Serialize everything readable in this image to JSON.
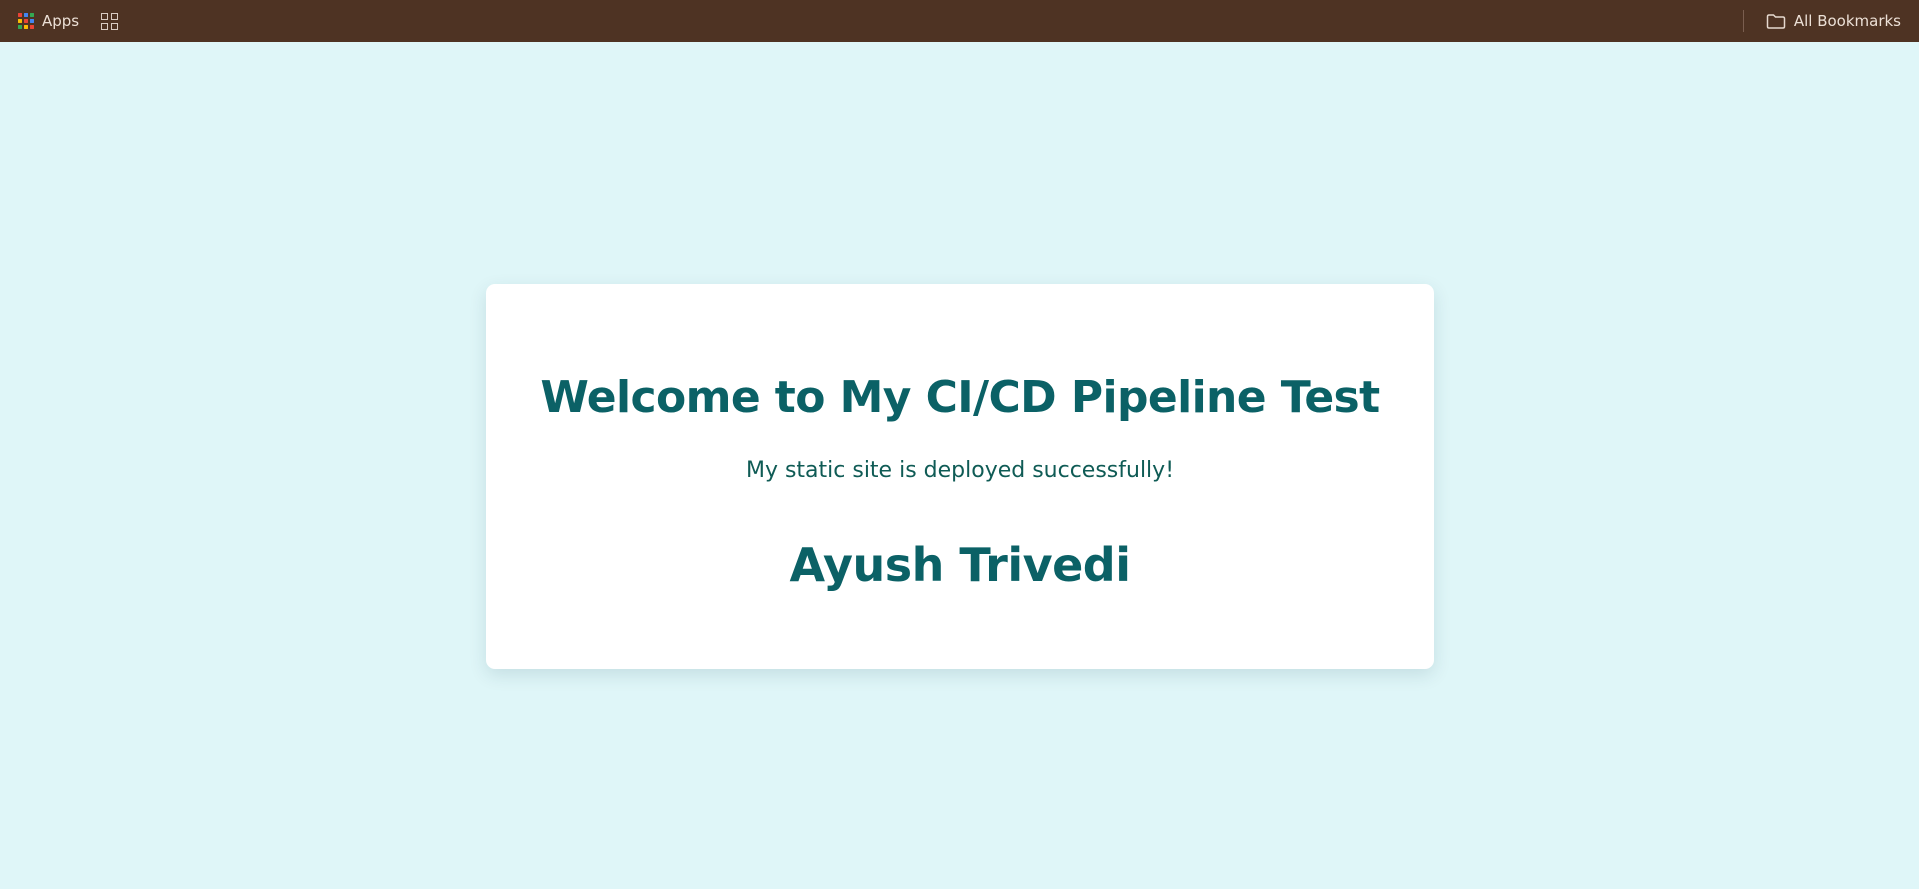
{
  "bookmarks_bar": {
    "apps_label": "Apps",
    "all_bookmarks_label": "All Bookmarks",
    "apps_icon_colors": [
      "#ea4335",
      "#4285f4",
      "#34a853",
      "#fbbc05",
      "#ea4335",
      "#4285f4",
      "#34a853",
      "#fbbc05",
      "#ea4335"
    ]
  },
  "page": {
    "heading": "Welcome to My CI/CD Pipeline Test",
    "subtext": "My static site is deployed successfully!",
    "author": "Ayush Trivedi"
  },
  "colors": {
    "background": "#dff6f8",
    "card": "#ffffff",
    "heading": "#0b6166",
    "bookmarks_bar": "#4e3323"
  }
}
